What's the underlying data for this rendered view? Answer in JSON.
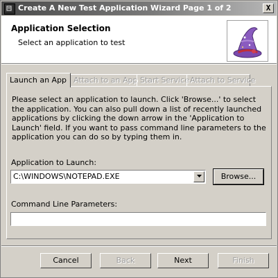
{
  "window": {
    "title": "Create A New Test Application Wizard Page 1 of 2",
    "close_symbol": "X",
    "app_icon": "app-icon"
  },
  "header": {
    "title": "Application Selection",
    "subtitle": "Select an application to test",
    "image": "wizard-hat-icon"
  },
  "tabs": [
    {
      "label": "Launch an App",
      "active": true
    },
    {
      "label": "Attach to an App",
      "active": false
    },
    {
      "label": "Start Service",
      "active": false
    },
    {
      "label": "Attach to Service",
      "active": false
    }
  ],
  "launch_tab": {
    "instructions": "Please select an application to launch.  Click 'Browse...' to select the application.  You can also pull down a list of recently launched applications by clicking the down arrow in the 'Application to Launch' field.  If you want to pass command line parameters to the application you can do so by typing them in.",
    "app_label": "Application to Launch:",
    "app_value": "C:\\WINDOWS\\NOTEPAD.EXE",
    "browse_label": "Browse...",
    "params_label": "Command Line Parameters:",
    "params_value": ""
  },
  "footer": {
    "cancel_label": "Cancel",
    "back_label": "Back",
    "next_label": "Next",
    "finish_label": "Finish"
  },
  "colors": {
    "face": "#d4d0c8",
    "title_start": "#4a4a4a",
    "title_end": "#b8b8b8",
    "hat_purple": "#8a5bbf",
    "hat_ribbon": "#c0303a"
  }
}
